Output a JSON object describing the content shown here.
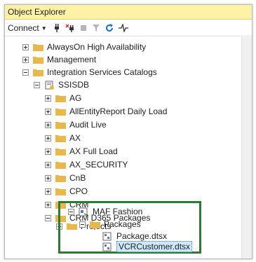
{
  "window": {
    "title": "Object Explorer"
  },
  "toolbar": {
    "connect_label": "Connect"
  },
  "tree": {
    "items": [
      {
        "label": "AlwaysOn High Availability"
      },
      {
        "label": "Management"
      },
      {
        "label": "Integration Services Catalogs"
      },
      {
        "label": "SSISDB"
      },
      {
        "label": "AG"
      },
      {
        "label": "AllEntityReport Daily Load"
      },
      {
        "label": "Audit Live"
      },
      {
        "label": "AX"
      },
      {
        "label": "AX Full Load"
      },
      {
        "label": "AX_SECURITY"
      },
      {
        "label": "CnB"
      },
      {
        "label": "CPO"
      },
      {
        "label": "CRM"
      },
      {
        "label": "CRM D365 Packages"
      },
      {
        "label": "Projects"
      },
      {
        "label": "MAF Fashion"
      },
      {
        "label": "Packages"
      },
      {
        "label": "Package.dtsx"
      },
      {
        "label": "VCRCustomer.dtsx"
      }
    ]
  },
  "colors": {
    "title_bg": "#fff1a6",
    "highlight": "#2d7a32",
    "folder": "#e8b84a",
    "selection": "#cde8ff"
  }
}
